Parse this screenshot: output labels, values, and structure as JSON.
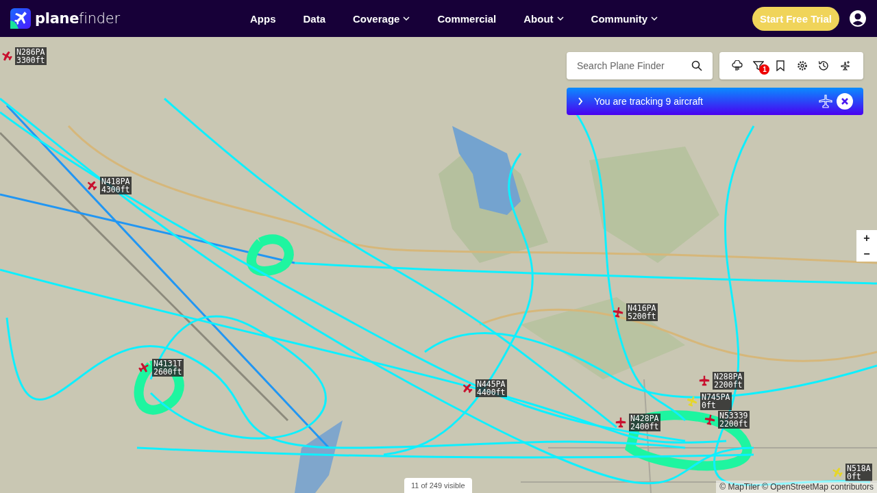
{
  "header": {
    "logo": {
      "bold": "plane",
      "light": "finder"
    },
    "nav": [
      {
        "label": "Apps",
        "dropdown": false
      },
      {
        "label": "Data",
        "dropdown": false
      },
      {
        "label": "Coverage",
        "dropdown": true
      },
      {
        "label": "Commercial",
        "dropdown": false
      },
      {
        "label": "About",
        "dropdown": true
      },
      {
        "label": "Community",
        "dropdown": true
      }
    ],
    "cta": "Start Free Trial"
  },
  "map": {
    "search": {
      "placeholder": "Search Plane Finder"
    },
    "toolbar": {
      "filter_badge": "1"
    },
    "tracking_banner": {
      "text": "You are tracking 9 aircraft"
    },
    "zoom": {
      "in": "+",
      "out": "−"
    },
    "aircraft": [
      {
        "callsign": "N286PA",
        "altitude": "3300ft",
        "color": "#c8102e"
      },
      {
        "callsign": "N418PA",
        "altitude": "4300ft",
        "color": "#c8102e"
      },
      {
        "callsign": "N4131T",
        "altitude": "2600ft",
        "color": "#c8102e"
      },
      {
        "callsign": "N445PA",
        "altitude": "4400ft",
        "color": "#c8102e"
      },
      {
        "callsign": "N416PA",
        "altitude": "5200ft",
        "color": "#c8102e"
      },
      {
        "callsign": "N288PA",
        "altitude": "2200ft",
        "color": "#c8102e"
      },
      {
        "callsign": "N745PA",
        "altitude": "0ft",
        "color": "#e6d62a"
      },
      {
        "callsign": "N428PA",
        "altitude": "2400ft",
        "color": "#c8102e"
      },
      {
        "callsign": "N53339",
        "altitude": "2200ft",
        "color": "#c8102e"
      },
      {
        "callsign": "N518A",
        "altitude": "0ft",
        "color": "#e6d62a"
      }
    ],
    "visible_count": "11 of 249 visible",
    "attribution": "© MapTiler © OpenStreetMap contributors"
  }
}
